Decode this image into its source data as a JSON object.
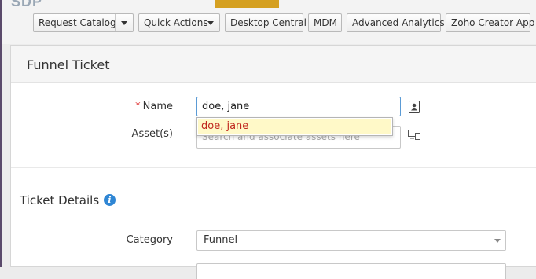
{
  "toolbar": {
    "items": [
      {
        "label": "Request Catalog",
        "has_dropdown": true
      },
      {
        "label": "Quick Actions",
        "has_dropdown": true
      },
      {
        "label": "Desktop Central",
        "has_dropdown": false
      },
      {
        "label": "MDM",
        "has_dropdown": false
      },
      {
        "label": "Advanced Analytics",
        "has_dropdown": false
      },
      {
        "label": "Zoho Creator App",
        "has_dropdown": false
      }
    ]
  },
  "form": {
    "title": "Funnel Ticket",
    "name": {
      "label": "Name",
      "required_marker": "*",
      "value": "doe, jane",
      "icon": "contact-card-icon"
    },
    "assets": {
      "label": "Asset(s)",
      "placeholder": "Search and associate assets here",
      "icon": "asset-devices-icon"
    },
    "autocomplete": {
      "suggestion": "doe, jane"
    },
    "section": {
      "title": "Ticket Details",
      "icon": "info-icon"
    },
    "category": {
      "label": "Category",
      "value": "Funnel"
    }
  },
  "colors": {
    "accent_yellow": "#d5a021",
    "required": "#dd2222",
    "info_icon": "#2f86d4",
    "suggestion_bg": "#fff9c8",
    "suggestion_text": "#c0271e"
  }
}
